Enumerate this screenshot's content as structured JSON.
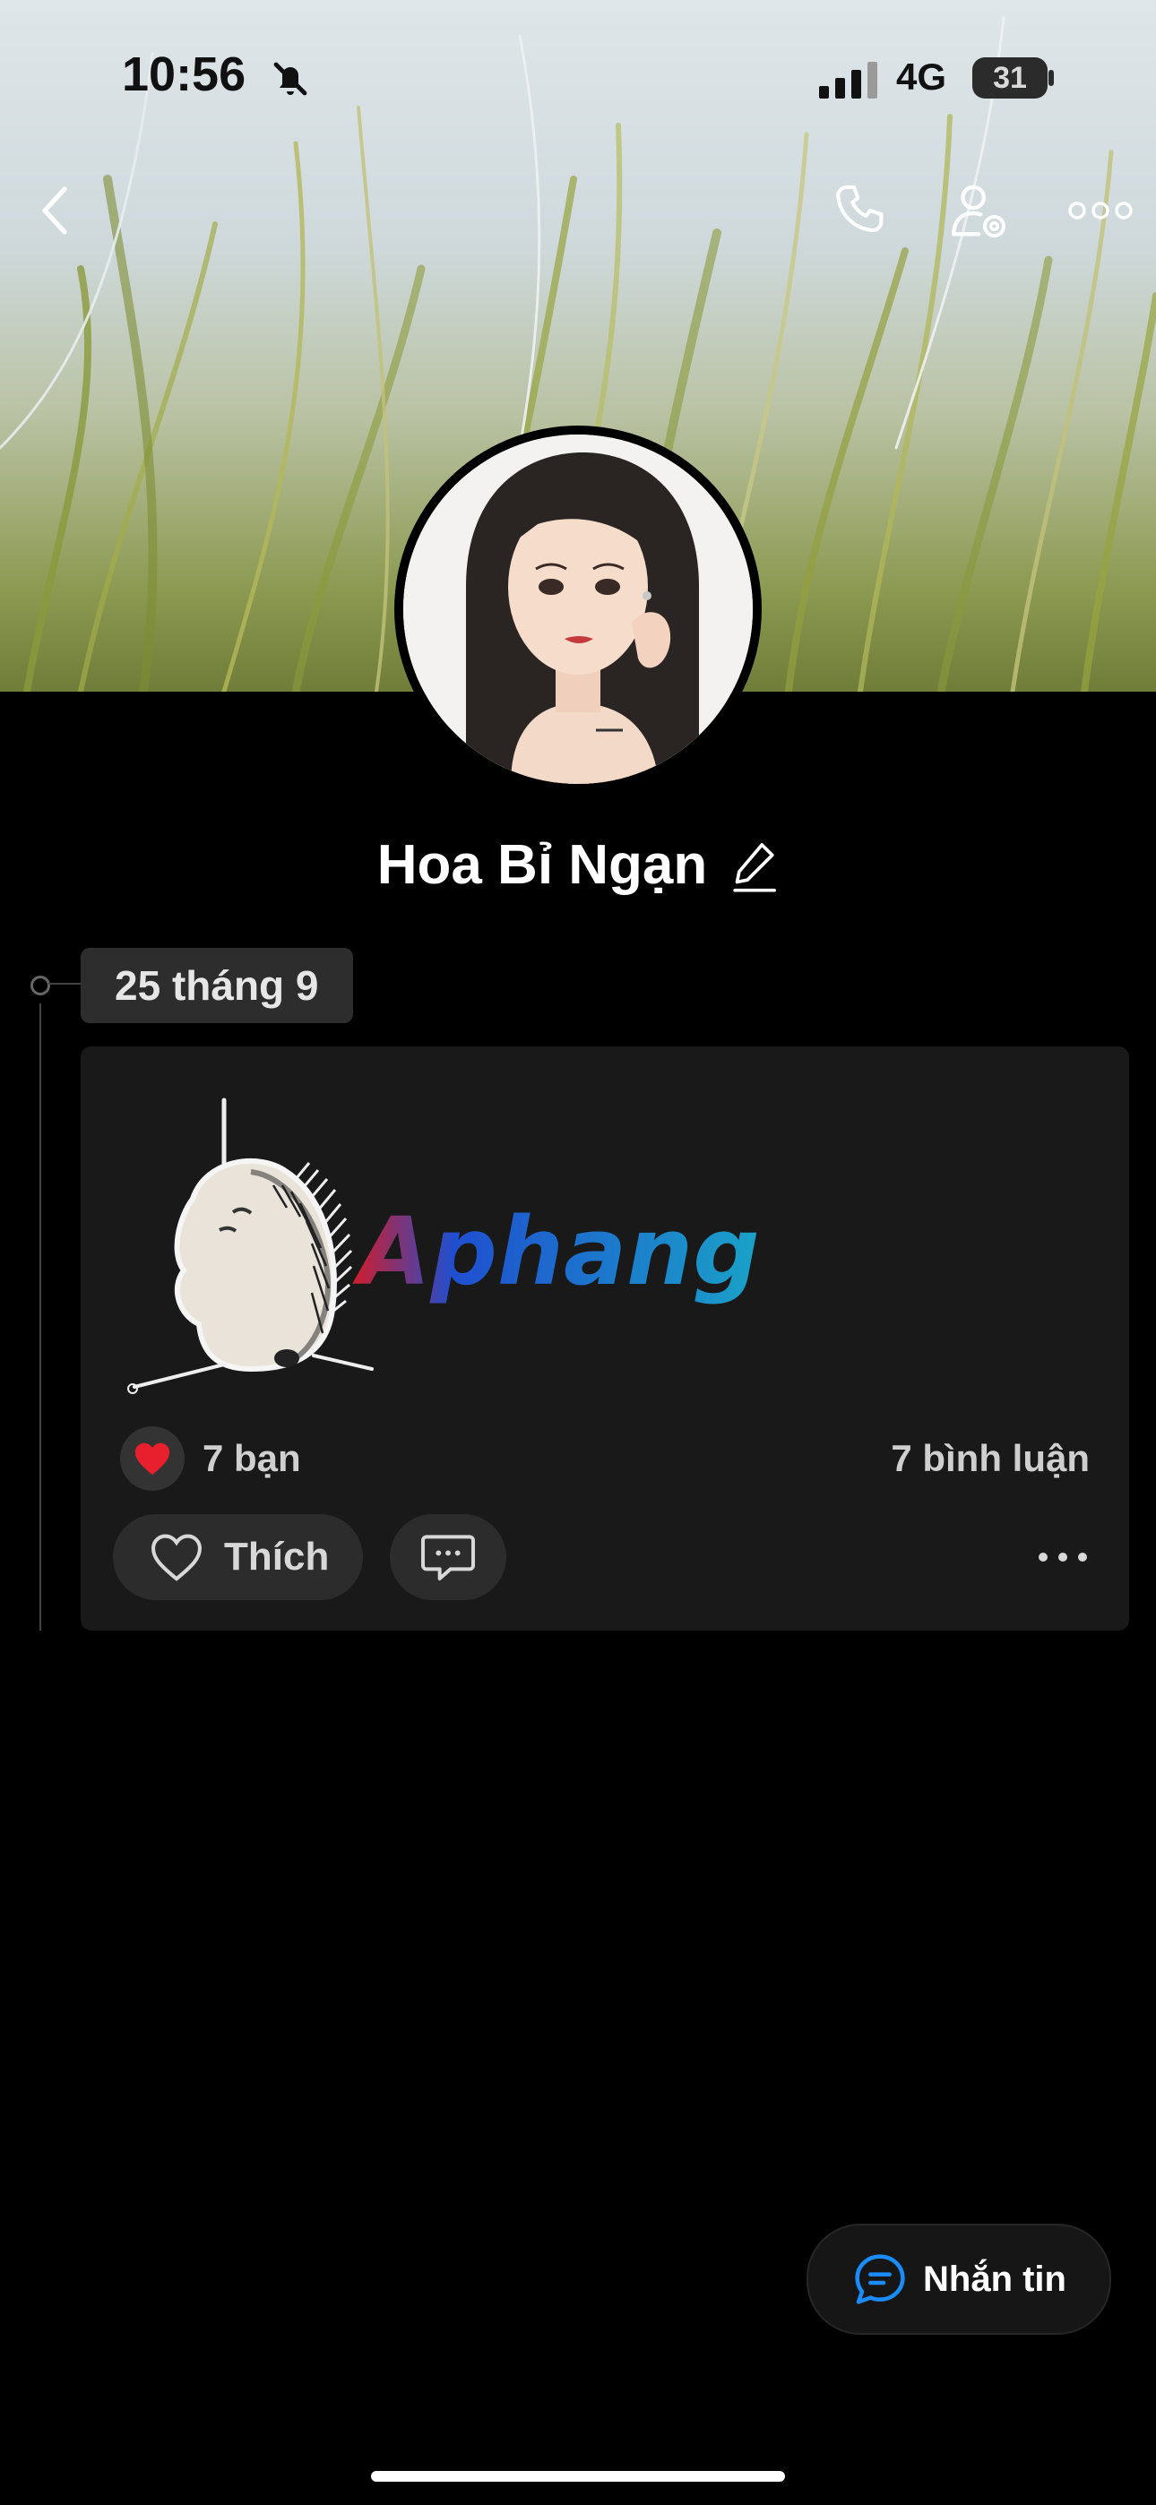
{
  "status_bar": {
    "time": "10:56",
    "network": "4G",
    "battery": "31"
  },
  "profile": {
    "name": "Hoa Bỉ Ngạn"
  },
  "timeline": {
    "date_label": "25 tháng 9",
    "post": {
      "sticker_text": "Aphang",
      "reactions_label": "7 bạn",
      "comments_label": "7 bình luận",
      "like_label": "Thích"
    }
  },
  "message_button": {
    "label": "Nhắn tin"
  },
  "icons": {
    "back": "chevron-left-icon",
    "call": "phone-icon",
    "settings": "user-settings-icon",
    "more": "more-horizontal-icon",
    "mute": "bell-off-icon",
    "edit": "pencil-icon",
    "heart": "heart-icon",
    "comment": "chat-bubble-icon",
    "message": "message-icon"
  },
  "colors": {
    "accent": "#1a8cff",
    "heart": "#e8202e",
    "card_bg": "#191919"
  }
}
